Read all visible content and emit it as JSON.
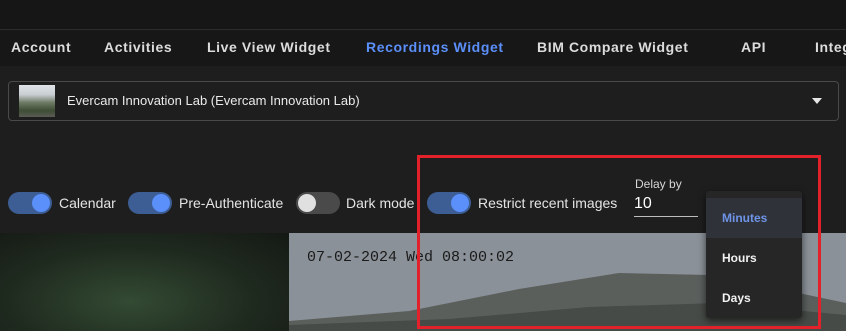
{
  "tabs": [
    {
      "label": "Account",
      "active": false
    },
    {
      "label": "Activities",
      "active": false
    },
    {
      "label": "Live View Widget",
      "active": false
    },
    {
      "label": "Recordings Widget",
      "active": true
    },
    {
      "label": "BIM Compare Widget",
      "active": false
    },
    {
      "label": "API",
      "active": false
    },
    {
      "label": "Integ",
      "active": false
    }
  ],
  "camera": {
    "label": "Evercam Innovation Lab (Evercam Innovation Lab)"
  },
  "toggles": [
    {
      "label": "Calendar",
      "on": true
    },
    {
      "label": "Pre-Authenticate",
      "on": true
    },
    {
      "label": "Dark mode",
      "on": false
    },
    {
      "label": "Restrict recent images",
      "on": true
    }
  ],
  "delay": {
    "label": "Delay by",
    "value": "10"
  },
  "unit_menu": {
    "items": [
      "Minutes",
      "Hours",
      "Days"
    ],
    "selected": "Minutes"
  },
  "preview": {
    "timestamp": "07-02-2024 Wed 08:00:02"
  },
  "colors": {
    "accent": "#5b8ff9",
    "highlight": "#e3212b"
  }
}
